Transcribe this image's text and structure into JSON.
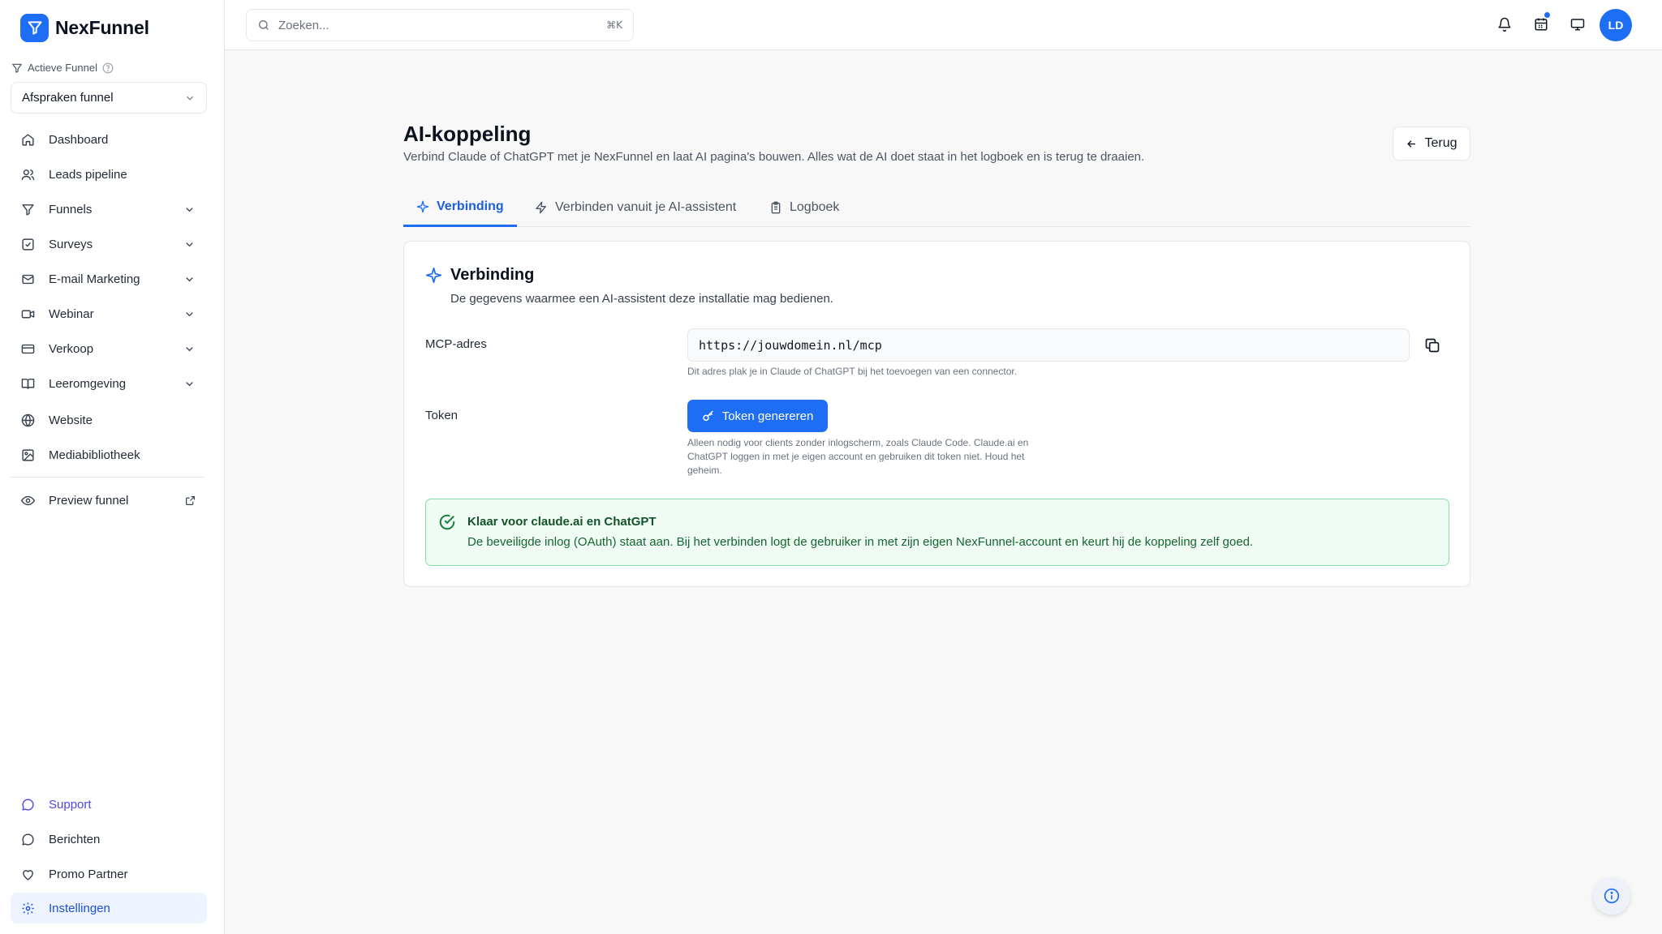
{
  "brand": {
    "name": "NexFunnel"
  },
  "sidebar": {
    "active_funnel_label": "Actieve Funnel",
    "funnel_select_value": "Afspraken funnel",
    "items": [
      {
        "label": "Dashboard",
        "icon": "home-icon"
      },
      {
        "label": "Leads pipeline",
        "icon": "users-icon"
      },
      {
        "label": "Funnels",
        "icon": "funnel-icon",
        "expandable": true
      },
      {
        "label": "Surveys",
        "icon": "checkbox-icon",
        "expandable": true
      },
      {
        "label": "E-mail Marketing",
        "icon": "mail-icon",
        "expandable": true
      },
      {
        "label": "Webinar",
        "icon": "video-icon",
        "expandable": true
      },
      {
        "label": "Verkoop",
        "icon": "credit-card-icon",
        "expandable": true
      },
      {
        "label": "Leeromgeving",
        "icon": "book-icon",
        "expandable": true
      },
      {
        "label": "Website",
        "icon": "globe-icon"
      },
      {
        "label": "Mediabibliotheek",
        "icon": "image-icon"
      }
    ],
    "preview": {
      "label": "Preview funnel",
      "icon": "eye-icon"
    },
    "bottom_items": [
      {
        "label": "Support",
        "icon": "chat-icon"
      },
      {
        "label": "Berichten",
        "icon": "message-icon"
      },
      {
        "label": "Promo Partner",
        "icon": "heart-icon"
      },
      {
        "label": "Instellingen",
        "icon": "gear-icon",
        "active": true
      }
    ]
  },
  "topbar": {
    "search_placeholder": "Zoeken...",
    "search_shortcut": "⌘K",
    "avatar_initials": "LD"
  },
  "page": {
    "title": "AI-koppeling",
    "subtitle": "Verbind Claude of ChatGPT met je NexFunnel en laat AI pagina's bouwen. Alles wat de AI doet staat in het logboek en is terug te draaien.",
    "back_label": "Terug",
    "tabs": [
      {
        "label": "Verbinding",
        "active": true
      },
      {
        "label": "Verbinden vanuit je AI-assistent"
      },
      {
        "label": "Logboek"
      }
    ]
  },
  "card": {
    "title": "Verbinding",
    "subtitle": "De gegevens waarmee een AI-assistent deze installatie mag bedienen.",
    "mcp_label": "MCP-adres",
    "mcp_value": "https://jouwdomein.nl/mcp",
    "mcp_hint": "Dit adres plak je in Claude of ChatGPT bij het toevoegen van een connector.",
    "token_label": "Token",
    "token_button": "Token genereren",
    "token_hint_lines": [
      "Alleen nodig voor clients zonder inlogscherm, zoals Claude Code. Claude.ai en",
      "ChatGPT loggen in met je eigen account en gebruiken dit token niet. Houd het",
      "geheim."
    ],
    "ready_title": "Klaar voor claude.ai en ChatGPT",
    "ready_text": "De beveiligde inlog (OAuth) staat aan. Bij het verbinden logt de gebruiker in met zijn eigen NexFunnel-account en keurt hij de koppeling zelf goed."
  },
  "colors": {
    "accent": "#1d6ef5",
    "success_bg": "#effbf3",
    "success_border": "#86dfa4",
    "success_text": "#166534"
  }
}
